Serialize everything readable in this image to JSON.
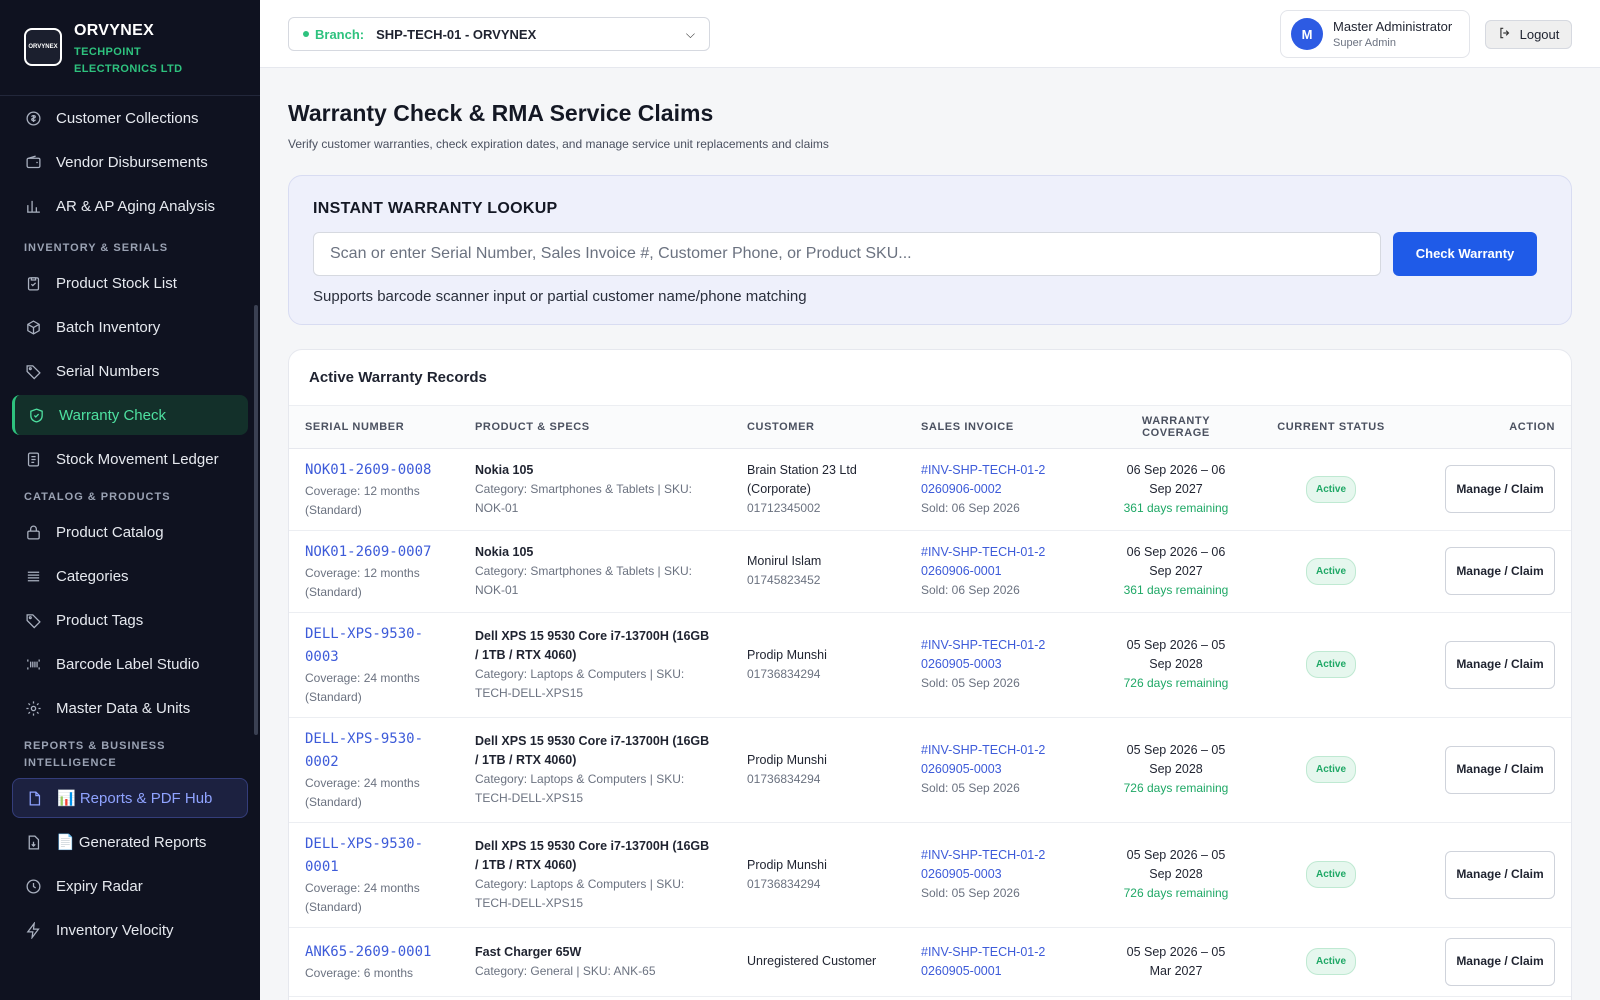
{
  "brand": {
    "name": "ORVYNEX",
    "subtitle": "TECHPOINT ELECTRONICS LTD",
    "logo_text": "ORVYNEX"
  },
  "sidebar": {
    "items_top": [
      {
        "label": "Customer Collections",
        "icon": "dollar-circle-icon"
      },
      {
        "label": "Vendor Disbursements",
        "icon": "wallet-icon"
      },
      {
        "label": "AR & AP Aging Analysis",
        "icon": "bar-chart-icon"
      }
    ],
    "section_inventory": "INVENTORY & SERIALS",
    "items_inventory": [
      {
        "label": "Product Stock List",
        "icon": "clipboard-icon"
      },
      {
        "label": "Batch Inventory",
        "icon": "box-icon"
      },
      {
        "label": "Serial Numbers",
        "icon": "tag-icon"
      },
      {
        "label": "Warranty Check",
        "icon": "shield-icon"
      },
      {
        "label": "Stock Movement Ledger",
        "icon": "ledger-icon"
      }
    ],
    "section_catalog": "CATALOG & PRODUCTS",
    "items_catalog": [
      {
        "label": "Product Catalog",
        "icon": "lock-icon"
      },
      {
        "label": "Categories",
        "icon": "list-icon"
      },
      {
        "label": "Product Tags",
        "icon": "tag-icon"
      },
      {
        "label": "Barcode Label Studio",
        "icon": "barcode-icon"
      },
      {
        "label": "Master Data & Units",
        "icon": "gear-icon"
      }
    ],
    "section_reports": "REPORTS & BUSINESS INTELLIGENCE",
    "items_reports": [
      {
        "label": "📊 Reports & PDF Hub",
        "icon": "document-icon"
      },
      {
        "label": "📄 Generated Reports",
        "icon": "document-download-icon"
      },
      {
        "label": "Expiry Radar",
        "icon": "clock-icon"
      },
      {
        "label": "Inventory Velocity",
        "icon": "bolt-icon"
      }
    ]
  },
  "topbar": {
    "branch_label": "Branch:",
    "branch_value": "SHP-TECH-01 - ORVYNEX",
    "user_initial": "M",
    "user_name": "Master Administrator",
    "user_role": "Super Admin",
    "logout_label": "Logout"
  },
  "page": {
    "title": "Warranty Check & RMA Service Claims",
    "subtitle": "Verify customer warranties, check expiration dates, and manage service unit replacements and claims"
  },
  "lookup": {
    "title": "INSTANT WARRANTY LOOKUP",
    "placeholder": "Scan or enter Serial Number, Sales Invoice #, Customer Phone, or Product SKU...",
    "button_label": "Check Warranty",
    "help": "Supports barcode scanner input or partial customer name/phone matching"
  },
  "records": {
    "title": "Active Warranty Records",
    "headers": [
      "SERIAL NUMBER",
      "PRODUCT & SPECS",
      "CUSTOMER",
      "SALES INVOICE",
      "WARRANTY COVERAGE",
      "CURRENT STATUS",
      "ACTION"
    ],
    "action_label": "Manage / Claim",
    "rows": [
      {
        "serial": "NOK01-2609-0008",
        "coverage": "Coverage: 12 months (Standard)",
        "product": "Nokia 105",
        "category": "Category: Smartphones & Tablets | SKU: NOK-01",
        "customer": "Brain Station 23 Ltd (Corporate)",
        "phone": "01712345002",
        "invoice": "#INV-SHP-TECH-01-20260906-0002",
        "sold": "Sold: 06 Sep 2026",
        "period": "06 Sep 2026 – 06 Sep 2027",
        "remaining": "361 days remaining",
        "status": "Active"
      },
      {
        "serial": "NOK01-2609-0007",
        "coverage": "Coverage: 12 months (Standard)",
        "product": "Nokia 105",
        "category": "Category: Smartphones & Tablets | SKU: NOK-01",
        "customer": "Monirul Islam",
        "phone": "01745823452",
        "invoice": "#INV-SHP-TECH-01-20260906-0001",
        "sold": "Sold: 06 Sep 2026",
        "period": "06 Sep 2026 – 06 Sep 2027",
        "remaining": "361 days remaining",
        "status": "Active"
      },
      {
        "serial": "DELL-XPS-9530-0003",
        "coverage": "Coverage: 24 months (Standard)",
        "product": "Dell XPS 15 9530 Core i7-13700H (16GB / 1TB / RTX 4060)",
        "category": "Category: Laptops & Computers | SKU: TECH-DELL-XPS15",
        "customer": "Prodip Munshi",
        "phone": "01736834294",
        "invoice": "#INV-SHP-TECH-01-20260905-0003",
        "sold": "Sold: 05 Sep 2026",
        "period": "05 Sep 2026 – 05 Sep 2028",
        "remaining": "726 days remaining",
        "status": "Active"
      },
      {
        "serial": "DELL-XPS-9530-0002",
        "coverage": "Coverage: 24 months (Standard)",
        "product": "Dell XPS 15 9530 Core i7-13700H (16GB / 1TB / RTX 4060)",
        "category": "Category: Laptops & Computers | SKU: TECH-DELL-XPS15",
        "customer": "Prodip Munshi",
        "phone": "01736834294",
        "invoice": "#INV-SHP-TECH-01-20260905-0003",
        "sold": "Sold: 05 Sep 2026",
        "period": "05 Sep 2026 – 05 Sep 2028",
        "remaining": "726 days remaining",
        "status": "Active"
      },
      {
        "serial": "DELL-XPS-9530-0001",
        "coverage": "Coverage: 24 months (Standard)",
        "product": "Dell XPS 15 9530 Core i7-13700H (16GB / 1TB / RTX 4060)",
        "category": "Category: Laptops & Computers | SKU: TECH-DELL-XPS15",
        "customer": "Prodip Munshi",
        "phone": "01736834294",
        "invoice": "#INV-SHP-TECH-01-20260905-0003",
        "sold": "Sold: 05 Sep 2026",
        "period": "05 Sep 2026 – 05 Sep 2028",
        "remaining": "726 days remaining",
        "status": "Active"
      },
      {
        "serial": "ANK65-2609-0001",
        "coverage": "Coverage: 6 months",
        "product": "Fast Charger 65W",
        "category": "Category: General | SKU: ANK-65",
        "customer": "Unregistered Customer",
        "phone": "",
        "invoice": "#INV-SHP-TECH-01-20260905-0001",
        "sold": "",
        "period": "05 Sep 2026 – 05 Mar 2027",
        "remaining": "",
        "status": "Active"
      }
    ]
  }
}
